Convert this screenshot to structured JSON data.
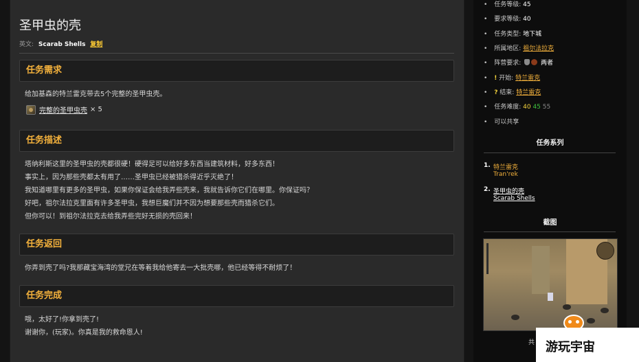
{
  "quest": {
    "title": "圣甲虫的壳",
    "en_label": "英文:",
    "en_name": "Scarab Shells",
    "copy_label": "复制"
  },
  "requirements": {
    "heading": "任务需求",
    "text": "给加基森的特兰雷克带去5个完整的圣甲虫壳。",
    "item_name": "完整的圣甲虫壳",
    "item_qty": "× 5",
    "item_icon": "scarab-shell-icon"
  },
  "description": {
    "heading": "任务描述",
    "lines": [
      "塔纳利斯这里的圣甲虫的壳都很硬！硬得足可以给好多东西当建筑材料，好多东西！",
      "事实上，因为那些壳都太有用了……圣甲虫已经被猎杀得近乎灭绝了！",
      "我知道哪里有更多的圣甲虫，如果你保证会给我弄些壳来，我就告诉你它们在哪里。你保证吗？",
      "好吧，祖尔法拉克里面有许多圣甲虫，我想巨魔们并不因为想要那些壳而猎杀它们。",
      "但你可以！到祖尔法拉克去给我弄些完好无损的壳回来！"
    ]
  },
  "progress": {
    "heading": "任务返回",
    "text": "你弄到壳了吗?我那藏宝海湾的堂兄在等着我给他寄去一大批壳哪，他已经等得不耐烦了！"
  },
  "completion": {
    "heading": "任务完成",
    "lines": [
      "哦，太好了!你拿到壳了!",
      "谢谢你，(玩家)。你真是我的救命恩人!"
    ]
  },
  "sidebar": {
    "quest_level_label": "任务等级:",
    "quest_level": "45",
    "req_level_label": "要求等级:",
    "req_level": "40",
    "type_label": "任务类型:",
    "type": "地下城",
    "zone_label": "所属地区:",
    "zone": "祖尔法拉克",
    "faction_label": "阵营要求:",
    "faction": "两者",
    "start_label": "开始:",
    "start_npc": "特兰雷克",
    "end_label": "结束:",
    "end_npc": "特兰雷克",
    "difficulty_label": "任务难度:",
    "difficulty": [
      "40",
      "45",
      "55"
    ],
    "shareable": "可以共享",
    "series_heading": "任务系列",
    "series": [
      {
        "num": "1.",
        "cn": "特兰雷克",
        "en": "Tran'rek"
      },
      {
        "num": "2.",
        "cn": "圣甲虫的壳",
        "en": "Scarab Shells"
      }
    ],
    "screenshot_heading": "截图",
    "screenshot_caption": "共"
  },
  "watermark": {
    "text": "游玩宇宙"
  },
  "colors": {
    "accent": "#f3b13c",
    "level_yellow": "#f3d23c",
    "level_green": "#3ec43e",
    "level_gray": "#8a8a8a"
  }
}
